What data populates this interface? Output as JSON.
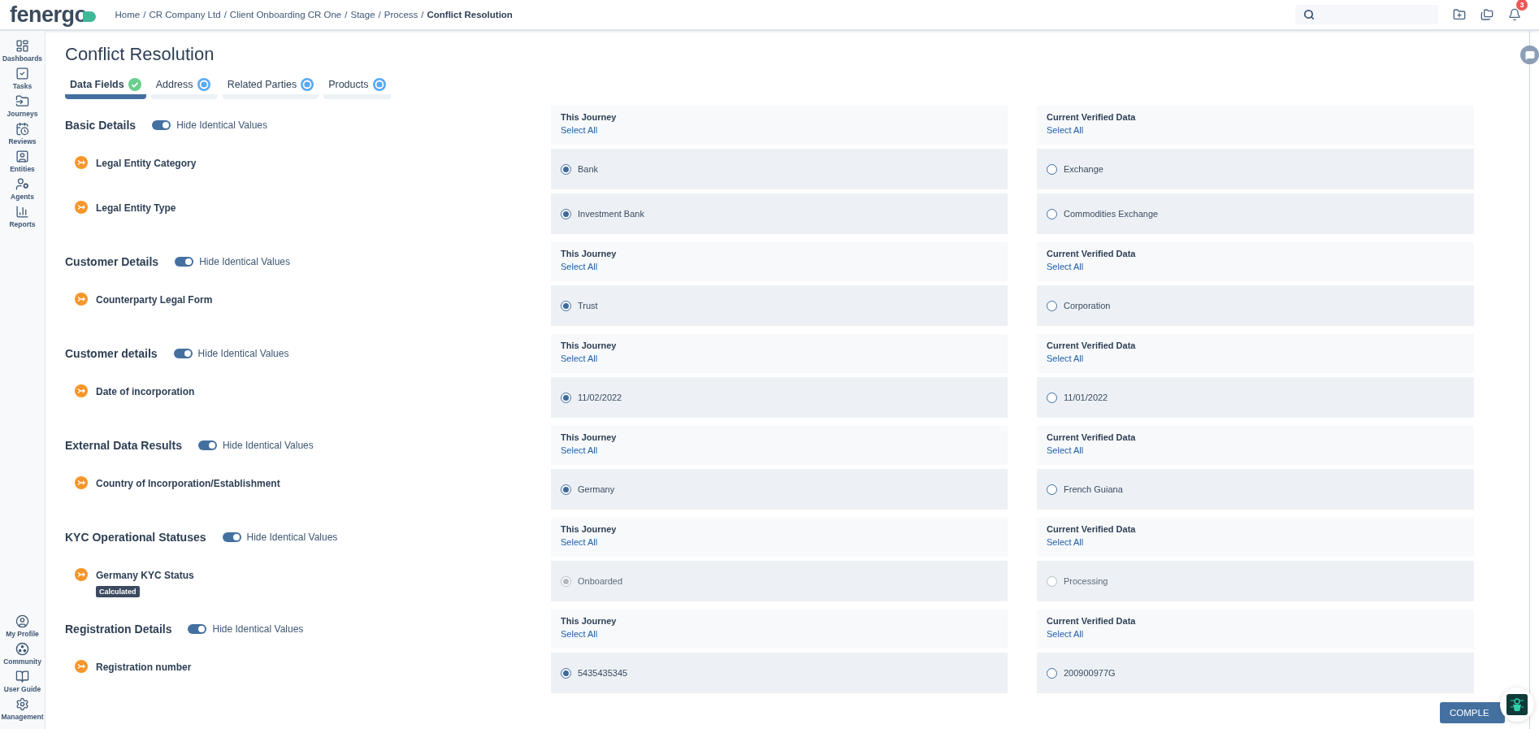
{
  "header": {
    "logo": "fenergo",
    "separator": "/",
    "breadcrumb": [
      {
        "label": "Home",
        "current": false
      },
      {
        "label": "CR Company Ltd",
        "current": false
      },
      {
        "label": "Client Onboarding CR One",
        "current": false
      },
      {
        "label": "Stage",
        "current": false
      },
      {
        "label": "Process",
        "current": false
      },
      {
        "label": "Conflict Resolution",
        "current": true
      }
    ],
    "notifications": "3"
  },
  "sidebar": {
    "items": [
      {
        "label": "Dashboards"
      },
      {
        "label": "Tasks"
      },
      {
        "label": "Journeys"
      },
      {
        "label": "Reviews"
      },
      {
        "label": "Entities"
      },
      {
        "label": "Agents"
      },
      {
        "label": "Reports"
      }
    ],
    "bottom_items": [
      {
        "label": "My Profile"
      },
      {
        "label": "Community"
      },
      {
        "label": "User Guide"
      },
      {
        "label": "Management"
      }
    ]
  },
  "title": "Conflict Resolution",
  "tabs": [
    {
      "label": "Data Fields",
      "kind": "complete",
      "selected": true
    },
    {
      "label": "Address",
      "kind": "pending",
      "selected": false
    },
    {
      "label": "Related Parties",
      "kind": "pending",
      "selected": false
    },
    {
      "label": "Products",
      "kind": "pending",
      "selected": false
    }
  ],
  "sections": [
    {
      "title": "Basic Details",
      "toggle": {
        "label": "Hide Identical Values",
        "on": true
      },
      "journey_header": {
        "title": "This Journey",
        "action": "Select All"
      },
      "verified_header": {
        "title": "Current Verified Data",
        "action": "Select All"
      },
      "fields": [
        {
          "label": "Legal Entity Category",
          "disabled": false,
          "journey": {
            "value": "Bank",
            "selected": true
          },
          "verified": {
            "value": "Exchange",
            "selected": false
          }
        },
        {
          "label": "Legal Entity Type",
          "disabled": false,
          "journey": {
            "value": "Investment Bank",
            "selected": true
          },
          "verified": {
            "value": "Commodities Exchange",
            "selected": false
          }
        }
      ]
    },
    {
      "title": "Customer Details",
      "toggle": {
        "label": "Hide Identical Values",
        "on": true
      },
      "journey_header": {
        "title": "This Journey",
        "action": "Select All"
      },
      "verified_header": {
        "title": "Current Verified Data",
        "action": "Select All"
      },
      "fields": [
        {
          "label": "Counterparty Legal Form",
          "disabled": false,
          "journey": {
            "value": "Trust",
            "selected": true
          },
          "verified": {
            "value": "Corporation",
            "selected": false
          }
        }
      ]
    },
    {
      "title": "Customer details",
      "toggle": {
        "label": "Hide Identical Values",
        "on": true
      },
      "journey_header": {
        "title": "This Journey",
        "action": "Select All"
      },
      "verified_header": {
        "title": "Current Verified Data",
        "action": "Select All"
      },
      "fields": [
        {
          "label": "Date of incorporation",
          "disabled": false,
          "journey": {
            "value": "11/02/2022",
            "selected": true
          },
          "verified": {
            "value": "11/01/2022",
            "selected": false
          }
        }
      ]
    },
    {
      "title": "External Data Results",
      "toggle": {
        "label": "Hide Identical Values",
        "on": true
      },
      "journey_header": {
        "title": "This Journey",
        "action": "Select All"
      },
      "verified_header": {
        "title": "Current Verified Data",
        "action": "Select All"
      },
      "fields": [
        {
          "label": "Country of Incorporation/Establishment",
          "disabled": false,
          "journey": {
            "value": "Germany",
            "selected": true
          },
          "verified": {
            "value": "French Guiana",
            "selected": false
          }
        }
      ]
    },
    {
      "title": "KYC Operational Statuses",
      "toggle": {
        "label": "Hide Identical Values",
        "on": true
      },
      "journey_header": {
        "title": "This Journey",
        "action": "Select All"
      },
      "verified_header": {
        "title": "Current Verified Data",
        "action": "Select All"
      },
      "fields": [
        {
          "label": "Germany KYC Status",
          "badge": "Calculated",
          "disabled": true,
          "journey": {
            "value": "Onboarded",
            "selected": true
          },
          "verified": {
            "value": "Processing",
            "selected": false
          }
        }
      ]
    },
    {
      "title": "Registration Details",
      "toggle": {
        "label": "Hide Identical Values",
        "on": true
      },
      "journey_header": {
        "title": "This Journey",
        "action": "Select All"
      },
      "verified_header": {
        "title": "Current Verified Data",
        "action": "Select All"
      },
      "fields": [
        {
          "label": "Registration number",
          "disabled": false,
          "journey": {
            "value": "5435435345",
            "selected": true
          },
          "verified": {
            "value": "200900977G",
            "selected": false
          }
        }
      ]
    }
  ],
  "complete_button": "COMPLE"
}
